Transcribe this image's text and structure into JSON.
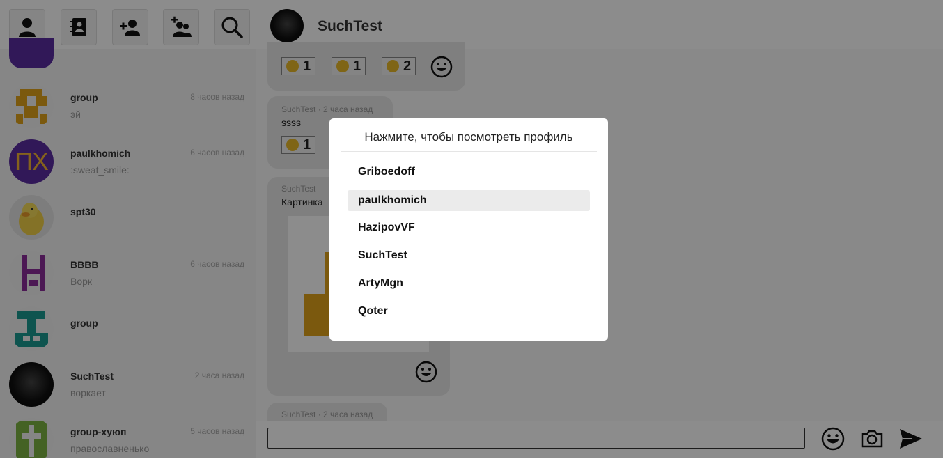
{
  "toolbar": {
    "buttons": [
      {
        "icon": "user-icon"
      },
      {
        "icon": "contacts-book-icon"
      },
      {
        "icon": "add-user-icon"
      },
      {
        "icon": "add-group-icon"
      },
      {
        "icon": "search-icon"
      }
    ]
  },
  "chats": [
    {
      "name": "group",
      "time": "8 часов назад",
      "preview": "эй"
    },
    {
      "name": "paulkhomich",
      "time": "6 часов назад",
      "preview": ":sweat_smile:",
      "avatar_text": "ПХ"
    },
    {
      "name": "spt30",
      "time": "",
      "preview": ""
    },
    {
      "name": "BBBB",
      "time": "6 часов назад",
      "preview": "Ворк"
    },
    {
      "name": "group",
      "time": "",
      "preview": ""
    },
    {
      "name": "SuchTest",
      "time": "2 часа назад",
      "preview": "воркает"
    },
    {
      "name": "group-хуюп",
      "time": "5 часов назад",
      "preview": "православненько"
    }
  ],
  "header": {
    "title": "SuchTest"
  },
  "messages": {
    "m1_reactions": [
      {
        "count": "1"
      },
      {
        "count": "1"
      },
      {
        "count": "2"
      }
    ],
    "m2": {
      "meta": "SuchTest · 2 часа назад",
      "text": "ssss",
      "reaction_count": "1"
    },
    "m3": {
      "meta": "SuchTest",
      "text": "Картинка"
    },
    "m4": {
      "meta": "SuchTest · 2 часа назад"
    }
  },
  "composer": {
    "placeholder": ""
  },
  "modal": {
    "title": "Нажмите, чтобы посмотреть профиль",
    "members": [
      "Griboedoff",
      "paulkhomich",
      "HazipovVF",
      "SuchTest",
      "ArtyMgn",
      "Qoter"
    ],
    "hovered_index": 1
  }
}
